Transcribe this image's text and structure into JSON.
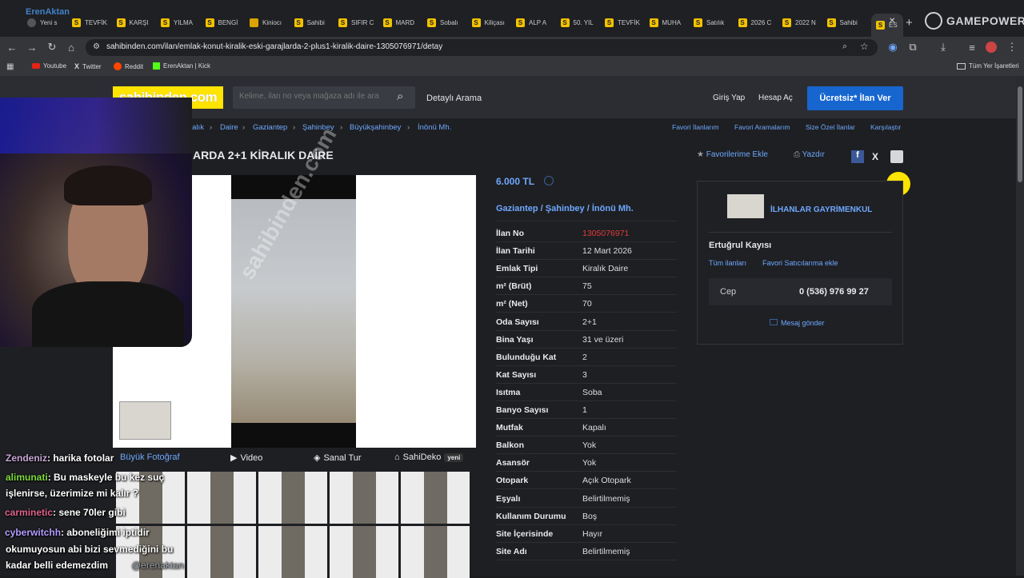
{
  "browser": {
    "tabs": [
      {
        "label": "Yeni s"
      },
      {
        "label": "TEVFİK"
      },
      {
        "label": "KARŞI"
      },
      {
        "label": "YILMA"
      },
      {
        "label": "BENGİ"
      },
      {
        "label": "Kiniocı"
      },
      {
        "label": "Sahibi"
      },
      {
        "label": "SIFIR C"
      },
      {
        "label": "MARD"
      },
      {
        "label": "Sobalı"
      },
      {
        "label": "Kiliçası"
      },
      {
        "label": "ALP A"
      },
      {
        "label": "50. YIL"
      },
      {
        "label": "TEVFİK"
      },
      {
        "label": "MUHA"
      },
      {
        "label": "Satılık"
      },
      {
        "label": "2026 C"
      },
      {
        "label": "2022 N"
      },
      {
        "label": "Sahibi"
      },
      {
        "label": "ES"
      }
    ],
    "url": "sahibinden.com/ilan/emlak-konut-kiralik-eski-garajlarda-2-plus1-kiralik-daire-1305076971/detay",
    "bookmarks": [
      "Youtube",
      "Twitter",
      "Reddit",
      "ErenAktan | Kick"
    ],
    "all_bookmarks": "Tüm Yer İşaretleri",
    "overlay_brand": "GAMEPOWER",
    "streamer_tag": "ErenAktan"
  },
  "header": {
    "logo": "sahibinden.com",
    "search_placeholder": "Kelime, ilan no veya mağaza adı ile ara",
    "detailed_search": "Detaylı Arama",
    "login": "Giriş Yap",
    "register": "Hesap Aç",
    "cta": "Ücretsiz* İlan Ver"
  },
  "breadcrumb": [
    "ralık",
    "Daire",
    "Gaziantep",
    "Şahinbey",
    "Büyükşahinbey",
    "İnönü Mh."
  ],
  "top_links": [
    "Favori İlanlarım",
    "Favori Aramalarım",
    "Size Özel İlanlar",
    "Karşılaştır"
  ],
  "listing": {
    "title": "ARDA 2+1 KİRALIK DAİRE",
    "add_fav": "Favorilerime Ekle",
    "print": "Yazdır",
    "price": "6.000 TL",
    "location": [
      "Gaziantep",
      "Şahinbey",
      "İnönü Mh."
    ],
    "details": [
      {
        "k": "İlan No",
        "v": "1305076971"
      },
      {
        "k": "İlan Tarihi",
        "v": "12 Mart 2026"
      },
      {
        "k": "Emlak Tipi",
        "v": "Kiralık Daire"
      },
      {
        "k": "m² (Brüt)",
        "v": "75"
      },
      {
        "k": "m² (Net)",
        "v": "70"
      },
      {
        "k": "Oda Sayısı",
        "v": "2+1"
      },
      {
        "k": "Bina Yaşı",
        "v": "31 ve üzeri"
      },
      {
        "k": "Bulunduğu Kat",
        "v": "2"
      },
      {
        "k": "Kat Sayısı",
        "v": "3"
      },
      {
        "k": "Isıtma",
        "v": "Soba"
      },
      {
        "k": "Banyo Sayısı",
        "v": "1"
      },
      {
        "k": "Mutfak",
        "v": "Kapalı"
      },
      {
        "k": "Balkon",
        "v": "Yok"
      },
      {
        "k": "Asansör",
        "v": "Yok"
      },
      {
        "k": "Otopark",
        "v": "Açık Otopark"
      },
      {
        "k": "Eşyalı",
        "v": "Belirtilmemiş"
      },
      {
        "k": "Kullanım Durumu",
        "v": "Boş"
      },
      {
        "k": "Site İçerisinde",
        "v": "Hayır"
      },
      {
        "k": "Site Adı",
        "v": "Belirtilmemiş"
      }
    ]
  },
  "gallery": {
    "big_photo": "Büyük Fotoğraf",
    "video": "Video",
    "virtual_tour": "Sanal Tur",
    "sahideko": "SahiDeko",
    "new_badge": "yeni",
    "watermark": "sahibinden.com"
  },
  "seller": {
    "company": "İLHANLAR GAYRİMENKUL",
    "agent": "Ertuğrul Kayısı",
    "all_listings": "Tüm ilanları",
    "fav_seller": "Favori Satıcılarıma ekle",
    "phone_label": "Cep",
    "phone": "0 (536) 976 99 27",
    "message": "Mesaj gönder"
  },
  "chat": [
    {
      "user": "Zendeniz",
      "color": "#c9a6d8",
      "text": ": harika fotolar"
    },
    {
      "user": "alimunati",
      "color": "#7fdb3c",
      "text": ": Bu maskeyle bu kez suç"
    },
    {
      "user": "",
      "color": "#ffffff",
      "text": "işlenirse, üzerimize mi kalır ?"
    },
    {
      "user": "carminetic",
      "color": "#e0628b",
      "text": ": sene 70ler gibi"
    },
    {
      "user": "cyberwitchh",
      "color": "#b39cff",
      "text": ": aboneliğimi iptidir"
    },
    {
      "user": "",
      "color": "#ffffff",
      "text": "okumuyosun abi bizi sevmediğini bu"
    },
    {
      "user": "",
      "color": "#ffffff",
      "text": "kadar belli edemezdim"
    }
  ],
  "chat_handle": "@erenaktan",
  "colors": {
    "link": "#6ea8ff",
    "ilan_no": "#e03b3b",
    "cta": "#1766cf",
    "logo_bg": "#ffe400"
  }
}
